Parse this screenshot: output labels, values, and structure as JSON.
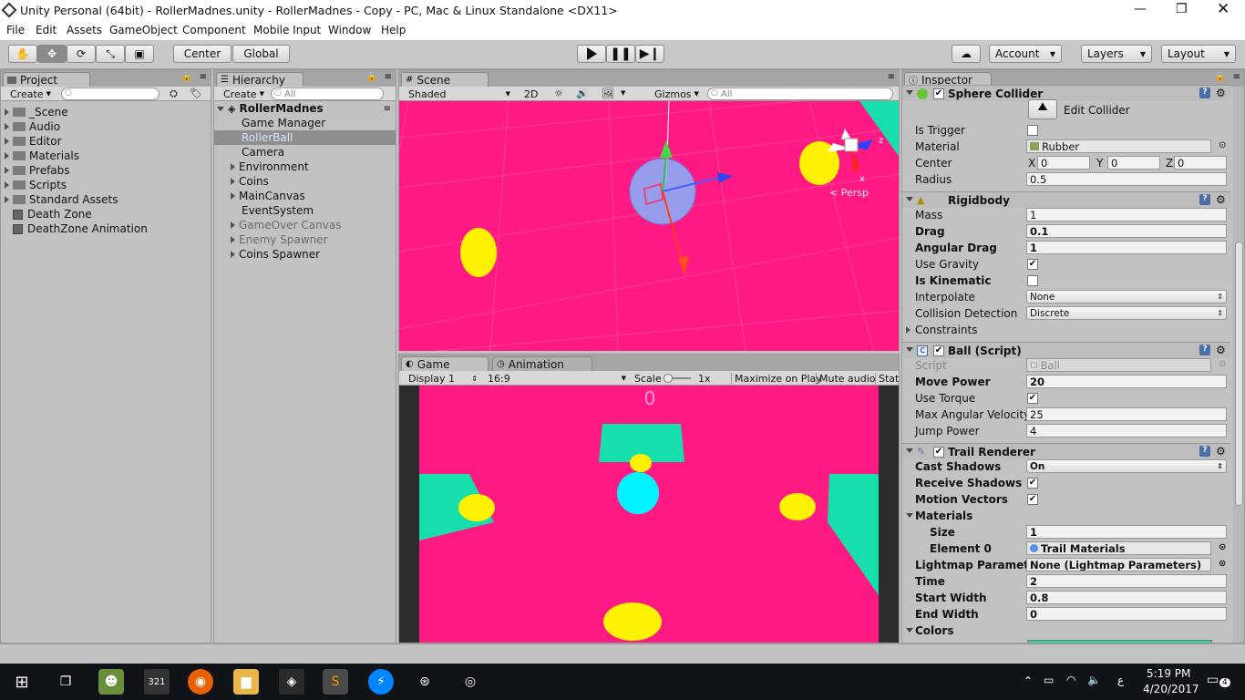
{
  "window": {
    "title": "Unity Personal (64bit) - RollerMadnes.unity - RollerMadnes - Copy - PC, Mac & Linux Standalone <DX11>"
  },
  "menu": [
    "File",
    "Edit",
    "Assets",
    "GameObject",
    "Component",
    "Mobile Input",
    "Window",
    "Help"
  ],
  "toolbar": {
    "center_label": "Center",
    "global_label": "Global",
    "account_label": "Account",
    "layers_label": "Layers",
    "layout_label": "Layout"
  },
  "project": {
    "tab": "Project",
    "create": "Create",
    "items": [
      {
        "label": "_Scene",
        "kind": "folder"
      },
      {
        "label": "Audio",
        "kind": "folder"
      },
      {
        "label": "Editor",
        "kind": "folder"
      },
      {
        "label": "Materials",
        "kind": "folder"
      },
      {
        "label": "Prefabs",
        "kind": "folder"
      },
      {
        "label": "Scripts",
        "kind": "folder"
      },
      {
        "label": "Standard Assets",
        "kind": "folder"
      },
      {
        "label": "Death Zone",
        "kind": "asset"
      },
      {
        "label": "DeathZone Animation",
        "kind": "asset"
      }
    ]
  },
  "hierarchy": {
    "tab": "Hierarchy",
    "create": "Create",
    "search_placeholder": "All",
    "root": "RollerMadnes",
    "items": [
      {
        "label": "Game Manager",
        "expand": false,
        "dim": false,
        "selected": false
      },
      {
        "label": "RollerBall",
        "expand": false,
        "dim": false,
        "selected": true
      },
      {
        "label": "Camera",
        "expand": false,
        "dim": false,
        "selected": false
      },
      {
        "label": "Environment",
        "expand": true,
        "dim": false,
        "selected": false
      },
      {
        "label": "Coins",
        "expand": true,
        "dim": false,
        "selected": false
      },
      {
        "label": "MainCanvas",
        "expand": true,
        "dim": false,
        "selected": false
      },
      {
        "label": "EventSystem",
        "expand": false,
        "dim": false,
        "selected": false
      },
      {
        "label": "GameOver Canvas",
        "expand": true,
        "dim": true,
        "selected": false
      },
      {
        "label": "Enemy Spawner",
        "expand": true,
        "dim": true,
        "selected": false
      },
      {
        "label": "Coins Spawner",
        "expand": true,
        "dim": false,
        "selected": false
      }
    ]
  },
  "scene": {
    "tab": "Scene",
    "shading": "Shaded",
    "mode2d": "2D",
    "gizmos": "Gizmos",
    "search_placeholder": "All",
    "persp": "Persp",
    "axis_z": "z",
    "axis_x": "x"
  },
  "game": {
    "tab": "Game",
    "tab2": "Animation",
    "display": "Display 1",
    "aspect": "16:9",
    "scale_label": "Scale",
    "scale_value": "1x",
    "maximize": "Maximize on Play",
    "mute": "Mute audio",
    "stats": "Stat",
    "score": "0"
  },
  "inspector": {
    "tab": "Inspector",
    "sphere_collider": {
      "title": "Sphere Collider",
      "edit_collider": "Edit Collider",
      "is_trigger": "Is Trigger",
      "material_label": "Material",
      "material_value": "Rubber",
      "center_label": "Center",
      "cx_label": "X",
      "cx": "0",
      "cy_label": "Y",
      "cy": "0",
      "cz_label": "Z",
      "cz": "0",
      "radius_label": "Radius",
      "radius": "0.5"
    },
    "rigidbody": {
      "title": "Rigidbody",
      "mass_label": "Mass",
      "mass": "1",
      "drag_label": "Drag",
      "drag": "0.1",
      "angular_drag_label": "Angular Drag",
      "angular_drag": "1",
      "use_gravity_label": "Use Gravity",
      "is_kinematic_label": "Is Kinematic",
      "interpolate_label": "Interpolate",
      "interpolate": "None",
      "collision_label": "Collision Detection",
      "collision": "Discrete",
      "constraints": "Constraints"
    },
    "ball_script": {
      "title": "Ball (Script)",
      "script_label": "Script",
      "script_value": "Ball",
      "move_power_label": "Move Power",
      "move_power": "20",
      "use_torque_label": "Use Torque",
      "max_ang_label": "Max Angular Velocity",
      "max_ang": "25",
      "jump_label": "Jump Power",
      "jump": "4"
    },
    "trail": {
      "title": "Trail Renderer",
      "cast_label": "Cast Shadows",
      "cast": "On",
      "receive_label": "Receive Shadows",
      "motion_label": "Motion Vectors",
      "materials_label": "Materials",
      "size_label": "Size",
      "size": "1",
      "elem0_label": "Element 0",
      "elem0": "Trail Materials",
      "lightmap_label": "Lightmap Paramet",
      "lightmap": "None (Lightmap Parameters)",
      "time_label": "Time",
      "time": "2",
      "start_label": "Start Width",
      "start": "0.8",
      "end_label": "End Width",
      "end": "0",
      "colors_label": "Colors"
    }
  },
  "taskbar": {
    "time": "5:19 PM",
    "date": "4/20/2017",
    "lang": "ع",
    "notif": "4"
  },
  "colors": {
    "magenta": "#ff1a83",
    "teal": "#17dfab",
    "yellow": "#fff200",
    "cyan": "#00f4ff",
    "selection": "#8e8e8e"
  }
}
